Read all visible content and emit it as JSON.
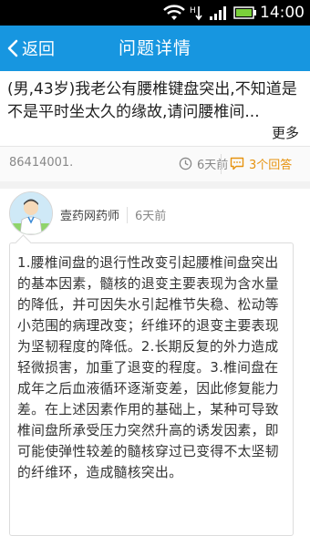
{
  "status_bar": {
    "time": "14:00"
  },
  "header": {
    "back_label": "返回",
    "title": "问题详情"
  },
  "question": {
    "text": "(男,43岁)我老公有腰椎键盘突出,不知道是不是平时坐太久的缘故,请问腰椎间...",
    "more_label": "更多"
  },
  "meta": {
    "user_id": "86414001.",
    "time_ago": "6天前",
    "answers_count": "3个回答"
  },
  "answer": {
    "author": "壹药网药师",
    "time_ago": "6天前",
    "body": "1.腰椎间盘的退行性改变引起腰椎间盘突出的基本因素，髓核的退变主要表现为含水量的降低，并可因失水引起椎节失稳、松动等小范围的病理改变；纤维环的退变主要表现为坚韧程度的降低。2.长期反复的外力造成轻微损害，加重了退变的程度。3.椎间盘在成年之后血液循环逐渐变差，因此修复能力差。在上述因素作用的基础上，某种可导致椎间盘所承受压力突然升高的诱发因素，即可能使弹性较差的髓核穿过已变得不太坚韧的纤维环，造成髓核突出。"
  },
  "colors": {
    "app_bar": "#1796e0",
    "accent": "#e6930f"
  },
  "icons": [
    "wifi-icon",
    "signal-icon",
    "battery-icon",
    "back-chevron-icon",
    "clock-icon",
    "comment-icon",
    "doctor-avatar"
  ]
}
